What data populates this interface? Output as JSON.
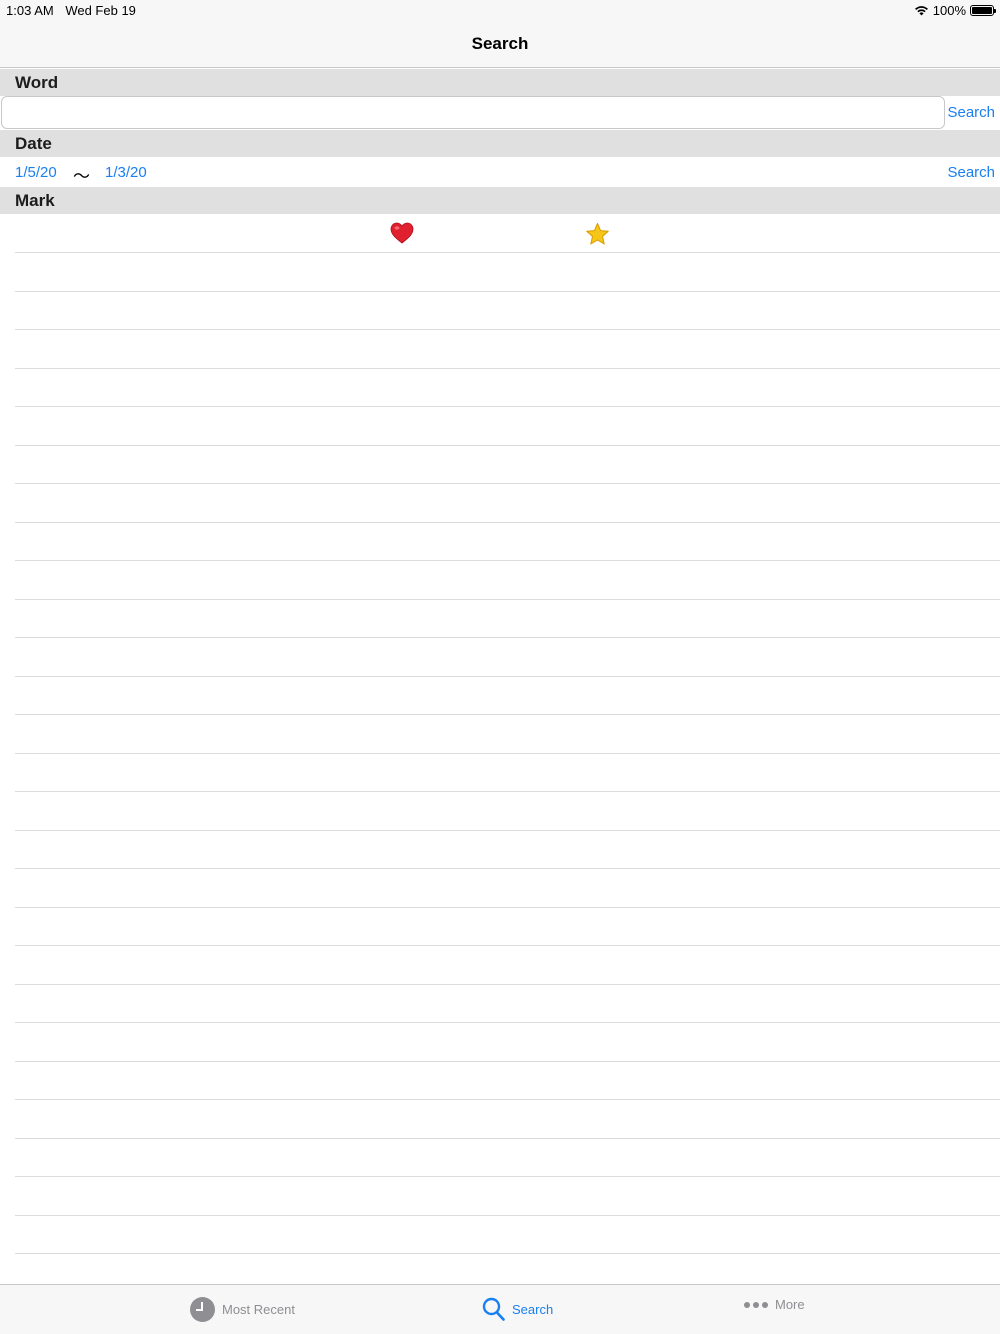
{
  "status_bar": {
    "time": "1:03 AM",
    "date": "Wed Feb 19",
    "battery": "100%"
  },
  "nav": {
    "title": "Search"
  },
  "word_section": {
    "header": "Word",
    "input_value": "",
    "input_placeholder": "",
    "search_label": "Search"
  },
  "date_section": {
    "header": "Date",
    "from": "1/5/20",
    "separator": "〜",
    "to": "1/3/20",
    "search_label": "Search"
  },
  "mark_section": {
    "header": "Mark",
    "icons": [
      "heart-icon",
      "star-icon"
    ]
  },
  "tabs": [
    {
      "label": "Most Recent",
      "icon": "clock-icon",
      "active": false
    },
    {
      "label": "Search",
      "icon": "magnifier-icon",
      "active": true
    },
    {
      "label": "More",
      "icon": "more-icon",
      "active": false
    }
  ],
  "colors": {
    "accent": "#1a7ff0",
    "heart": "#e0202e",
    "star": "#f5c518",
    "section_bg": "#e0e0e0",
    "bar_bg": "#f7f7f7"
  }
}
